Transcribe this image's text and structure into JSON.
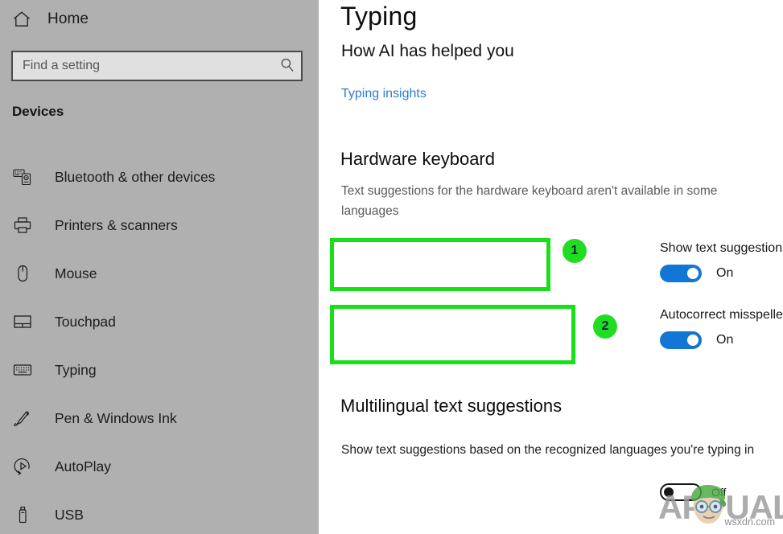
{
  "sidebar": {
    "home": {
      "label": "Home",
      "icon": "home-icon"
    },
    "search": {
      "value": "",
      "placeholder": "Find a setting",
      "icon": "search-icon"
    },
    "section_title": "Devices",
    "items": [
      {
        "label": "Bluetooth & other devices",
        "icon": "bluetooth-devices-icon"
      },
      {
        "label": "Printers & scanners",
        "icon": "printer-icon"
      },
      {
        "label": "Mouse",
        "icon": "mouse-icon"
      },
      {
        "label": "Touchpad",
        "icon": "touchpad-icon"
      },
      {
        "label": "Typing",
        "icon": "keyboard-icon"
      },
      {
        "label": "Pen & Windows Ink",
        "icon": "pen-icon"
      },
      {
        "label": "AutoPlay",
        "icon": "autoplay-icon"
      },
      {
        "label": "USB",
        "icon": "usb-icon"
      }
    ]
  },
  "main": {
    "page_title": "Typing",
    "sub_head": "How AI has helped you",
    "insights_link": "Typing insights",
    "hardware_keyboard": {
      "heading": "Hardware keyboard",
      "description": "Text suggestions for the hardware keyboard aren't available in some languages",
      "settings": [
        {
          "label": "Show text suggestions as I type",
          "state": "On",
          "on": true
        },
        {
          "label": "Autocorrect misspelled words I type",
          "state": "On",
          "on": true
        }
      ]
    },
    "multilingual": {
      "heading": "Multilingual text suggestions",
      "description": "Show text suggestions based on the recognized languages you're typing in",
      "setting": {
        "label": "",
        "state": "Off",
        "on": false
      }
    }
  },
  "annotations": {
    "highlight_color": "#18e018",
    "badge_color": "#21dd21",
    "badges": [
      {
        "number": "1"
      },
      {
        "number": "2"
      }
    ]
  },
  "watermarks": {
    "logo_text": "APPUALS",
    "site_credit": "wsxdn.com"
  },
  "colors": {
    "sidebar_bg": "#b0b0b0",
    "content_bg": "#ffffff",
    "accent_link": "#2b7cd3",
    "toggle_on": "#1277d4"
  }
}
